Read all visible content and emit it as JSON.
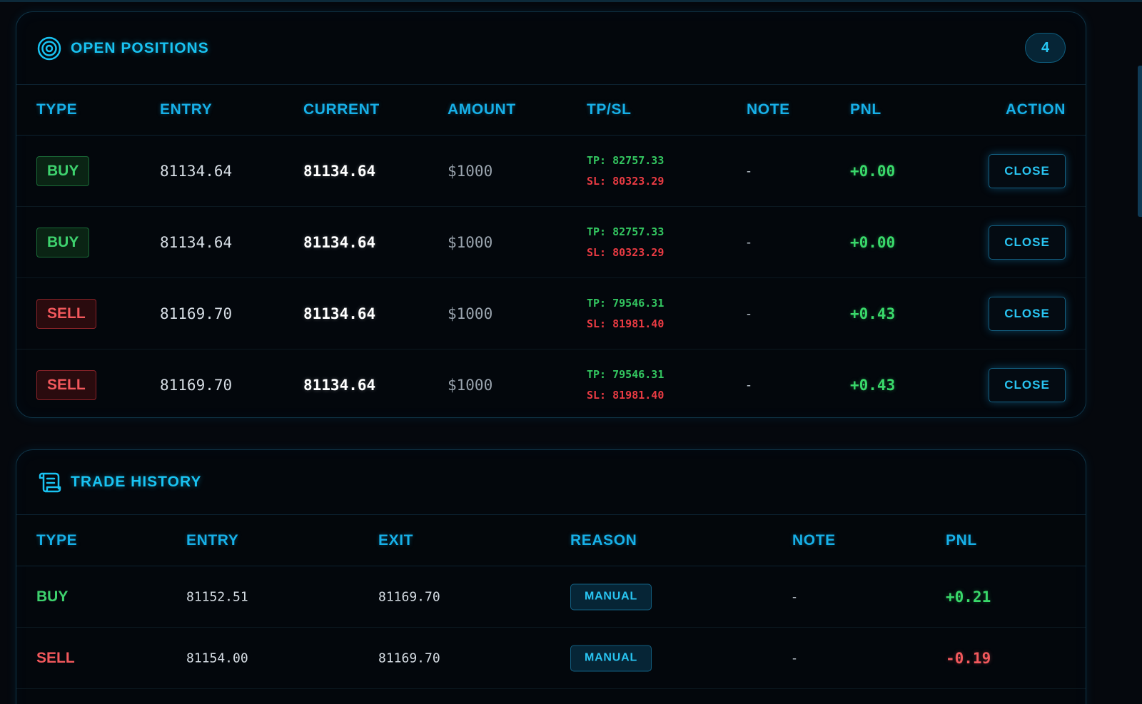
{
  "open_positions": {
    "title": "OPEN POSITIONS",
    "count": "4",
    "columns": {
      "type": "TYPE",
      "entry": "ENTRY",
      "current": "CURRENT",
      "amount": "AMOUNT",
      "tpsl": "TP/SL",
      "note": "NOTE",
      "pnl": "PNL",
      "action": "ACTION"
    },
    "rows": [
      {
        "type": "BUY",
        "entry": "81134.64",
        "current": "81134.64",
        "amount": "$1000",
        "tp": "TP: 82757.33",
        "sl": "SL: 80323.29",
        "note": "-",
        "pnl": "+0.00",
        "action": "CLOSE"
      },
      {
        "type": "BUY",
        "entry": "81134.64",
        "current": "81134.64",
        "amount": "$1000",
        "tp": "TP: 82757.33",
        "sl": "SL: 80323.29",
        "note": "-",
        "pnl": "+0.00",
        "action": "CLOSE"
      },
      {
        "type": "SELL",
        "entry": "81169.70",
        "current": "81134.64",
        "amount": "$1000",
        "tp": "TP: 79546.31",
        "sl": "SL: 81981.40",
        "note": "-",
        "pnl": "+0.43",
        "action": "CLOSE"
      },
      {
        "type": "SELL",
        "entry": "81169.70",
        "current": "81134.64",
        "amount": "$1000",
        "tp": "TP: 79546.31",
        "sl": "SL: 81981.40",
        "note": "-",
        "pnl": "+0.43",
        "action": "CLOSE"
      }
    ]
  },
  "trade_history": {
    "title": "TRADE HISTORY",
    "columns": {
      "type": "TYPE",
      "entry": "ENTRY",
      "exit": "EXIT",
      "reason": "REASON",
      "note": "NOTE",
      "pnl": "PNL"
    },
    "rows": [
      {
        "type": "BUY",
        "entry": "81152.51",
        "exit": "81169.70",
        "reason": "MANUAL",
        "note": "-",
        "pnl": "+0.21"
      },
      {
        "type": "SELL",
        "entry": "81154.00",
        "exit": "81169.70",
        "reason": "MANUAL",
        "note": "-",
        "pnl": "-0.19"
      }
    ]
  },
  "colors": {
    "accent": "#19c3f2",
    "buy": "#3ed26e",
    "sell": "#f2585c",
    "panel_bg": "#03070c"
  },
  "icons": {
    "open_positions": "target-icon",
    "trade_history": "scroll-icon"
  }
}
